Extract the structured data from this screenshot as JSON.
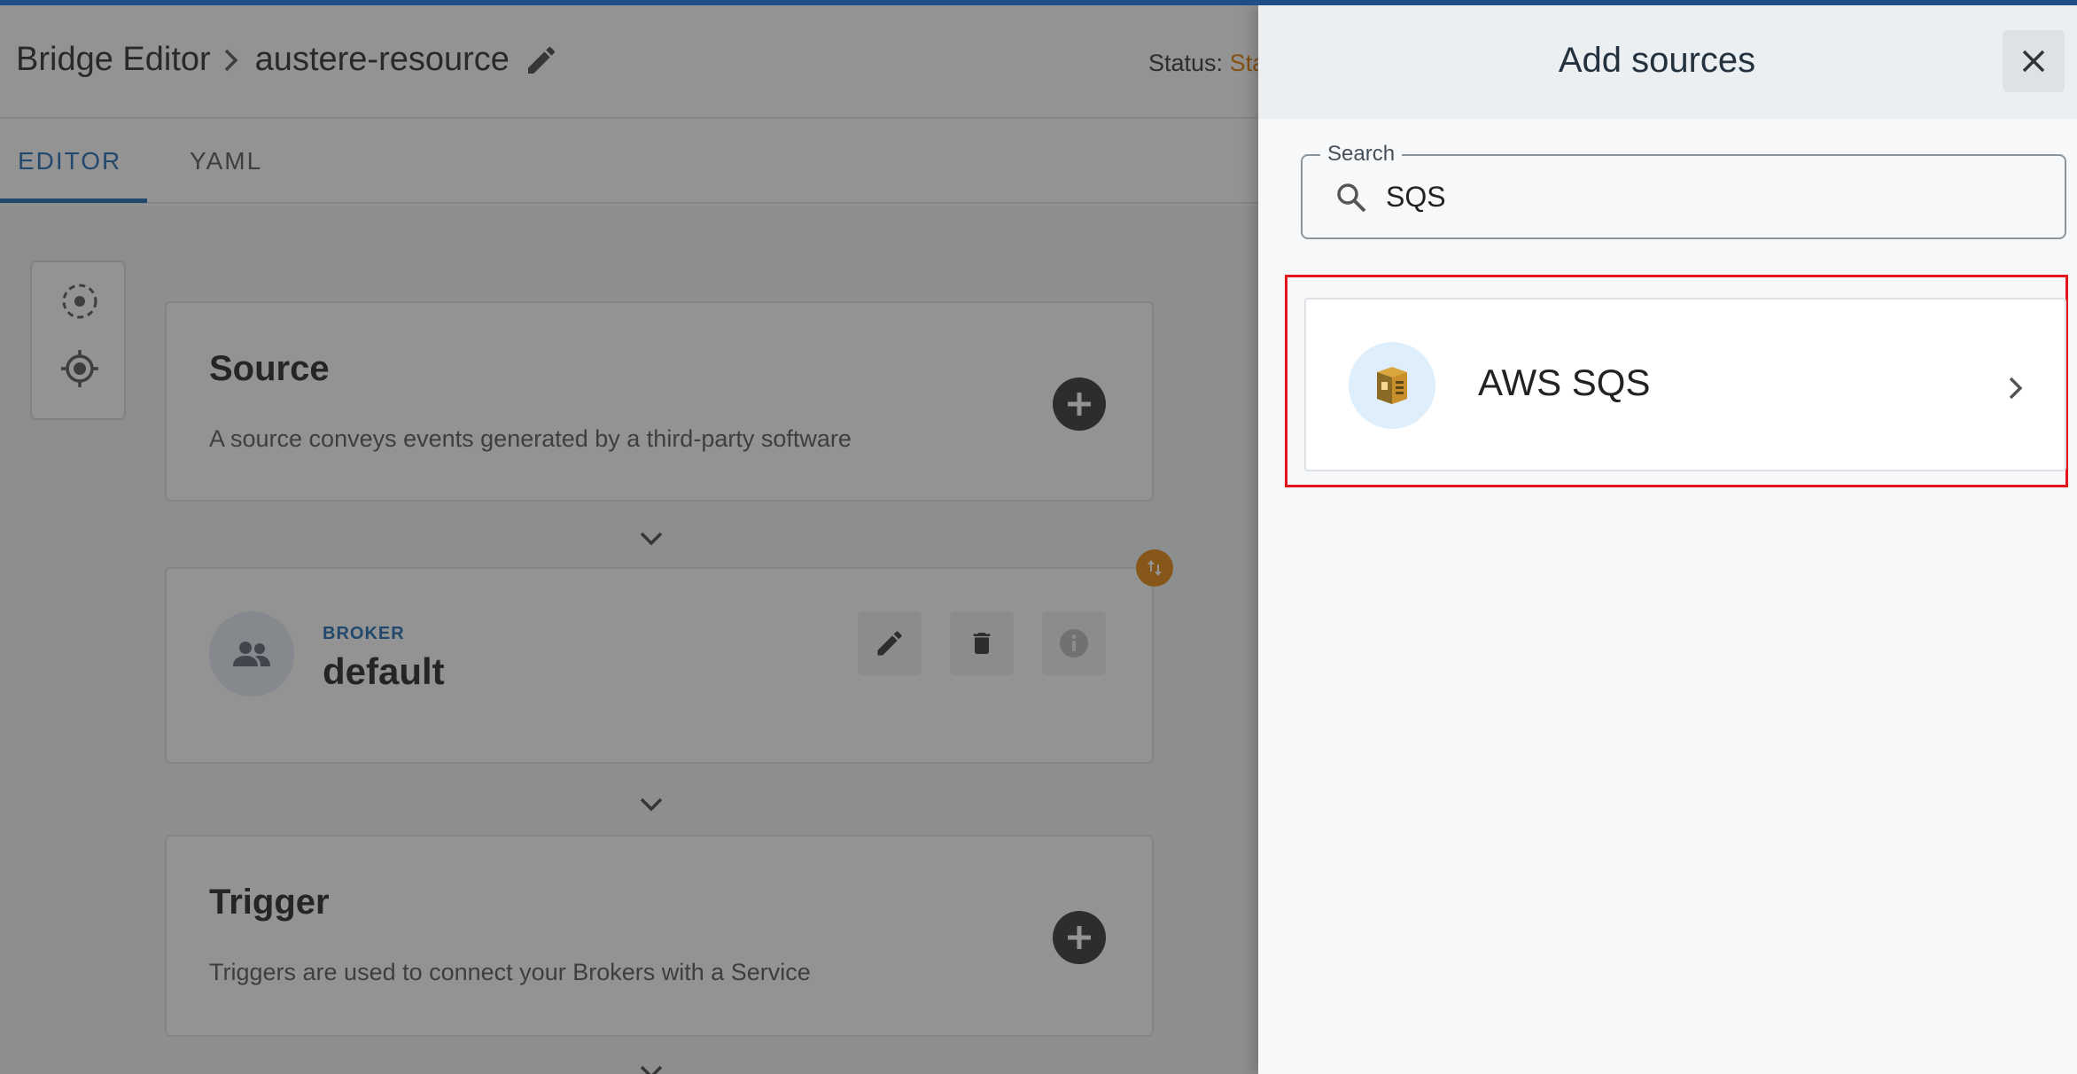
{
  "header": {
    "app_title": "Bridge Editor",
    "bridge_name": "austere-resource",
    "status_label": "Status:",
    "status_value": "Sta"
  },
  "tabs": [
    {
      "label": "EDITOR",
      "active": true
    },
    {
      "label": "YAML",
      "active": false
    }
  ],
  "canvas": {
    "source_card": {
      "title": "Source",
      "description": "A source conveys events generated by a third-party software"
    },
    "broker_card": {
      "kicker": "BROKER",
      "name": "default"
    },
    "trigger_card": {
      "title": "Trigger",
      "description": "Triggers are used to connect your Brokers with a Service"
    }
  },
  "drawer": {
    "title": "Add sources",
    "search": {
      "label": "Search",
      "value": "SQS"
    },
    "results": [
      {
        "label": "AWS SQS",
        "icon": "aws-sqs-icon"
      }
    ]
  },
  "colors": {
    "accent": "#1f69b3",
    "status": "#e07a00",
    "highlight": "#e3141c",
    "badge": "#e6870a"
  }
}
